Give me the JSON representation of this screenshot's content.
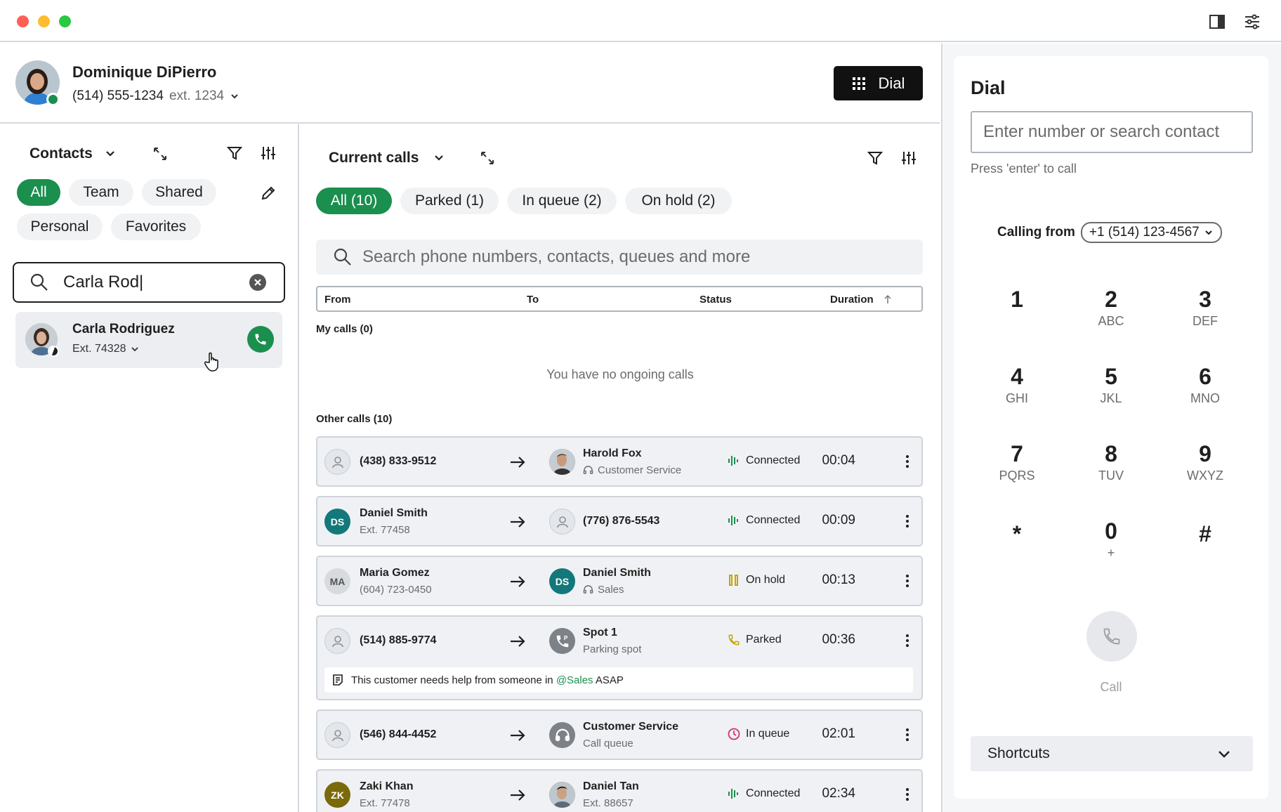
{
  "header": {
    "user_name": "Dominique DiPierro",
    "phone": "(514) 555-1234",
    "ext": "ext. 1234",
    "dial_button": "Dial",
    "presence_color": "#1a8f4e"
  },
  "contacts": {
    "title": "Contacts",
    "filters": [
      "All",
      "Team",
      "Shared",
      "Personal",
      "Favorites"
    ],
    "active_filter": "All",
    "search_value": "Carla Rod|",
    "result": {
      "name": "Carla Rodriguez",
      "ext": "Ext. 74328"
    }
  },
  "calls": {
    "title": "Current calls",
    "tabs": [
      "All (10)",
      "Parked (1)",
      "In queue (2)",
      "On hold (2)"
    ],
    "search_placeholder": "Search phone numbers, contacts, queues and more",
    "columns": {
      "from": "From",
      "to": "To",
      "status": "Status",
      "duration": "Duration"
    },
    "my_calls_label": "My calls (0)",
    "no_calls_text": "You have no ongoing calls",
    "other_calls_label": "Other calls (10)",
    "rows": [
      {
        "from": "(438) 833-9512",
        "from_sub": "",
        "to": "Harold Fox",
        "to_sub": "Customer Service",
        "status": "Connected",
        "duration": "00:04"
      },
      {
        "from_initials": "DS",
        "from": "Daniel Smith",
        "from_sub": "Ext. 77458",
        "to": "(776) 876-5543",
        "to_sub": "",
        "status": "Connected",
        "duration": "00:09"
      },
      {
        "from_initials": "MA",
        "from": "Maria Gomez",
        "from_sub": "(604) 723-0450",
        "to_initials": "DS",
        "to": "Daniel Smith",
        "to_sub": "Sales",
        "status": "On hold",
        "duration": "00:13"
      },
      {
        "from": "(514) 885-9774",
        "from_sub": "",
        "to": "Spot 1",
        "to_sub": "Parking spot",
        "status": "Parked",
        "duration": "00:36",
        "note_prefix": "This customer needs help from someone in ",
        "note_mention": "@Sales",
        "note_suffix": " ASAP"
      },
      {
        "from": "(546) 844-4452",
        "from_sub": "",
        "to": "Customer Service",
        "to_sub": "Call queue",
        "status": "In queue",
        "duration": "02:01"
      },
      {
        "from_initials": "ZK",
        "from": "Zaki Khan",
        "from_sub": "Ext. 77478",
        "to": "Daniel Tan",
        "to_sub": "Ext. 88657",
        "status": "Connected",
        "duration": "02:34"
      }
    ],
    "status_colors": {
      "connected": "#1a8f4e",
      "hold": "#c9a400",
      "parked": "#c9a400",
      "queue": "#d6336c"
    }
  },
  "dial": {
    "title": "Dial",
    "input_placeholder": "Enter number or search contact",
    "hint": "Press 'enter' to call",
    "calling_from_label": "Calling from",
    "calling_from_value": "+1 (514) 123-4567",
    "keys": [
      {
        "d": "1",
        "l": ""
      },
      {
        "d": "2",
        "l": "ABC"
      },
      {
        "d": "3",
        "l": "DEF"
      },
      {
        "d": "4",
        "l": "GHI"
      },
      {
        "d": "5",
        "l": "JKL"
      },
      {
        "d": "6",
        "l": "MNO"
      },
      {
        "d": "7",
        "l": "PQRS"
      },
      {
        "d": "8",
        "l": "TUV"
      },
      {
        "d": "9",
        "l": "WXYZ"
      },
      {
        "d": "*",
        "l": ""
      },
      {
        "d": "0",
        "l": "+"
      },
      {
        "d": "#",
        "l": ""
      }
    ],
    "call_label": "Call",
    "shortcuts_label": "Shortcuts"
  }
}
